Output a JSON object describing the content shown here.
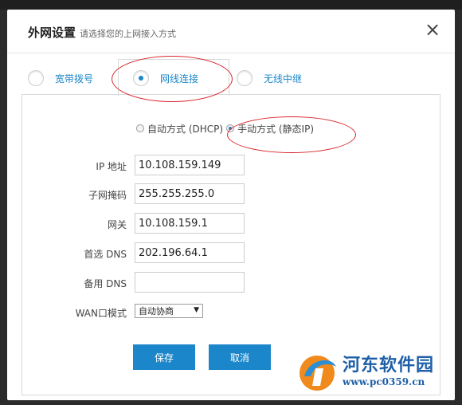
{
  "background": {
    "ghost_text": ""
  },
  "dialog": {
    "title": "外网设置",
    "subtitle": "请选择您的上网接入方式",
    "close_symbol": "×"
  },
  "tabs": [
    {
      "label": "宽带拨号",
      "selected": false
    },
    {
      "label": "网线连接",
      "selected": true
    },
    {
      "label": "无线中继",
      "selected": false
    }
  ],
  "modes": [
    {
      "label": "自动方式 (DHCP)",
      "selected": false
    },
    {
      "label": "手动方式 (静态IP)",
      "selected": true
    }
  ],
  "fields": {
    "ip": {
      "label": "IP 地址",
      "value": "10.108.159.149"
    },
    "mask": {
      "label": "子网掩码",
      "value": "255.255.255.0"
    },
    "gateway": {
      "label": "网关",
      "value": "10.108.159.1"
    },
    "dns1": {
      "label": "首选 DNS",
      "value": "202.196.64.1"
    },
    "dns2": {
      "label": "备用 DNS",
      "value": ""
    },
    "wan": {
      "label": "WAN口模式",
      "value": "自动协商"
    }
  },
  "buttons": {
    "save": "保存",
    "cancel": "取消"
  },
  "watermark": {
    "name": "河东软件园",
    "url": "www.pc0359.cn"
  },
  "colors": {
    "accent": "#1b86c9",
    "annotation": "#d9252b",
    "watermark": "#1e5fa8"
  }
}
